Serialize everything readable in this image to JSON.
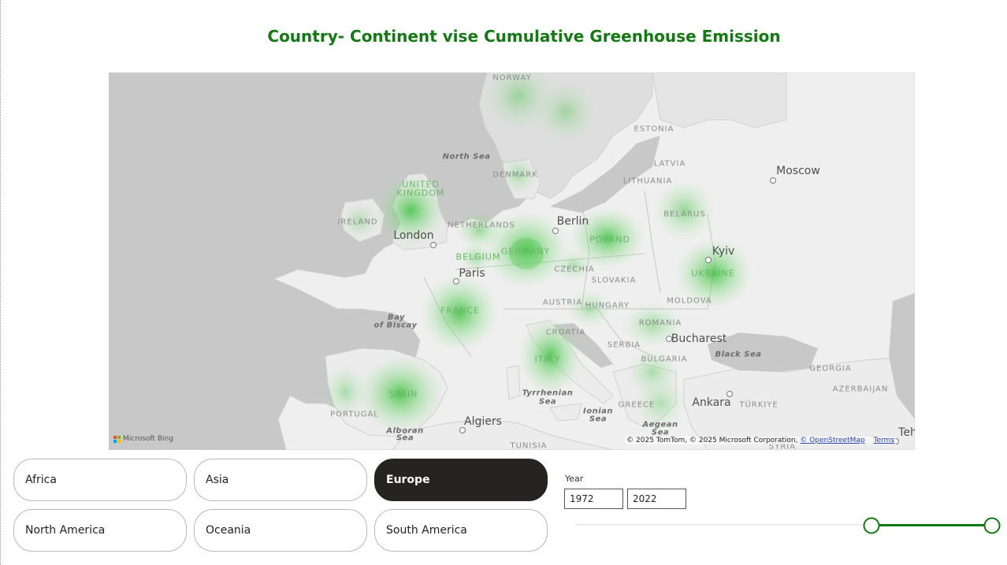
{
  "title": "Country- Continent vise Cumulative Greenhouse Emission",
  "map": {
    "country_labels": [
      {
        "name": "norway",
        "text": "NORWAY"
      },
      {
        "name": "estonia",
        "text": "ESTONIA"
      },
      {
        "name": "latvia",
        "text": "LATVIA"
      },
      {
        "name": "lithuania",
        "text": "LITHUANIA"
      },
      {
        "name": "denmark",
        "text": "DENMARK"
      },
      {
        "name": "united",
        "text": "UNITED"
      },
      {
        "name": "kingdom",
        "text": "KINGDOM"
      },
      {
        "name": "ireland",
        "text": "IRELAND"
      },
      {
        "name": "netherlands",
        "text": "NETHERLANDS"
      },
      {
        "name": "belgium",
        "text": "BELGIUM"
      },
      {
        "name": "germany",
        "text": "GERMANY"
      },
      {
        "name": "poland",
        "text": "POLAND"
      },
      {
        "name": "belarus",
        "text": "BELARUS"
      },
      {
        "name": "ukraine",
        "text": "UKRAINE"
      },
      {
        "name": "czechia",
        "text": "CZECHIA"
      },
      {
        "name": "slovakia",
        "text": "SLOVAKIA"
      },
      {
        "name": "austria",
        "text": "AUSTRIA"
      },
      {
        "name": "hungary",
        "text": "HUNGARY"
      },
      {
        "name": "moldova",
        "text": "MOLDOVA"
      },
      {
        "name": "romania",
        "text": "ROMANIA"
      },
      {
        "name": "france",
        "text": "FRANCE"
      },
      {
        "name": "croatia",
        "text": "CROATIA"
      },
      {
        "name": "serbia",
        "text": "SERBIA"
      },
      {
        "name": "bulgaria",
        "text": "BULGARIA"
      },
      {
        "name": "italy",
        "text": "ITALY"
      },
      {
        "name": "spain",
        "text": "SPAIN"
      },
      {
        "name": "portugal",
        "text": "PORTUGAL"
      },
      {
        "name": "greece",
        "text": "GREECE"
      },
      {
        "name": "turkiye",
        "text": "TÜRKIYE"
      },
      {
        "name": "georgia",
        "text": "GEORGIA"
      },
      {
        "name": "azerbaijan",
        "text": "AZERBAIJAN"
      },
      {
        "name": "syria",
        "text": "SYRIA"
      },
      {
        "name": "tunisia",
        "text": "TUNISIA"
      }
    ],
    "city_labels": [
      {
        "name": "moscow",
        "text": "Moscow"
      },
      {
        "name": "berlin",
        "text": "Berlin"
      },
      {
        "name": "london",
        "text": "London"
      },
      {
        "name": "paris",
        "text": "Paris"
      },
      {
        "name": "kyiv",
        "text": "Kyiv"
      },
      {
        "name": "bucharest",
        "text": "Bucharest"
      },
      {
        "name": "ankara",
        "text": "Ankara"
      },
      {
        "name": "algiers",
        "text": "Algiers"
      },
      {
        "name": "tehran",
        "text": "Teh"
      }
    ],
    "sea_labels": [
      {
        "name": "north-sea",
        "text": "North Sea"
      },
      {
        "name": "bay-of-biscay-1",
        "text": "Bay"
      },
      {
        "name": "bay-of-biscay-2",
        "text": "of Biscay"
      },
      {
        "name": "black-sea",
        "text": "Black Sea"
      },
      {
        "name": "tyrrhenian-1",
        "text": "Tyrrhenian"
      },
      {
        "name": "tyrrhenian-2",
        "text": "Sea"
      },
      {
        "name": "ionian-1",
        "text": "Ionian"
      },
      {
        "name": "ionian-2",
        "text": "Sea"
      },
      {
        "name": "aegean-1",
        "text": "Aegean"
      },
      {
        "name": "aegean-2",
        "text": "Sea"
      },
      {
        "name": "alboran-1",
        "text": "Alboran"
      },
      {
        "name": "alboran-2",
        "text": "Sea"
      }
    ],
    "heat_color": "#3fc03f",
    "heat_spots": [
      "GERMANY",
      "UNITED KINGDOM",
      "POLAND",
      "UKRAINE",
      "FRANCE",
      "ITALY",
      "SPAIN",
      "BELARUS",
      "ROMANIA",
      "NETHERLANDS",
      "NORWAY",
      "FINLAND",
      "CROATIA",
      "HUNGARY",
      "GREECE",
      "PORTUGAL",
      "BELGIUM",
      "CZECHIA",
      "DENMARK",
      "IRELAND"
    ],
    "bing_logo_text": "Microsoft Bing",
    "attribution_text": "© 2025 TomTom, © 2025 Microsoft Corporation,",
    "osm_link": "© OpenStreetMap",
    "terms_link": "Terms"
  },
  "continent_slicer": {
    "options": [
      {
        "label": "Africa",
        "selected": false
      },
      {
        "label": "Asia",
        "selected": false
      },
      {
        "label": "Europe",
        "selected": true
      },
      {
        "label": "North America",
        "selected": false
      },
      {
        "label": "Oceania",
        "selected": false
      },
      {
        "label": "South America",
        "selected": false
      }
    ]
  },
  "year_slicer": {
    "label": "Year",
    "start": "1972",
    "end": "2022",
    "accent_color": "#137a13"
  }
}
